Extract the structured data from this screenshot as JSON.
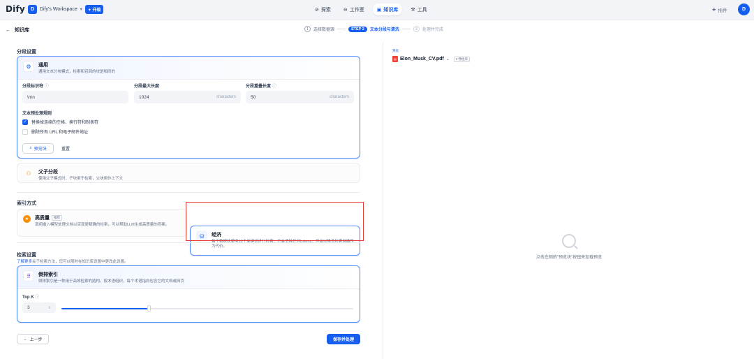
{
  "topbar": {
    "logo": "Dify",
    "workspace_initial": "D",
    "workspace_name": "Dify's Workspace",
    "upgrade_label": "升级",
    "nav": [
      {
        "label": "探索",
        "icon": "compass-icon"
      },
      {
        "label": "工作室",
        "icon": "robot-icon"
      },
      {
        "label": "知识库",
        "icon": "book-icon",
        "active": true
      },
      {
        "label": "工具",
        "icon": "tool-icon"
      }
    ],
    "plugins_label": "插件",
    "user_initial": "D"
  },
  "header": {
    "back_label": "知识库",
    "steps": {
      "step1_num": "1",
      "step1_label": "选择数据源",
      "step2_pill": "STEP 2",
      "step2_label": "文本分段与清洗",
      "step3_num": "3",
      "step3_label": "处理并完成"
    }
  },
  "segment": {
    "section_title": "分段设置",
    "general": {
      "title": "通用",
      "desc": "通用文本分块模式，检索和召回的块是相同的",
      "delimiter_label": "分段标识符",
      "delimiter_value": "\\n\\n",
      "maxlen_label": "分段最大长度",
      "maxlen_value": "1024",
      "maxlen_unit": "characters",
      "overlap_label": "分段重叠长度",
      "overlap_value": "50",
      "overlap_unit": "characters",
      "preprocess_title": "文本预处理规则",
      "rule1": "替换掉连续的空格、换行符和制表符",
      "rule1_checked": true,
      "rule2": "删除所有 URL 和电子邮件地址",
      "rule2_checked": false,
      "preview_btn": "预览块",
      "reset_btn": "重置"
    },
    "parent_child": {
      "title": "父子分段",
      "desc": "使用父子模式时，子块用于检索，父块用作上下文"
    }
  },
  "index": {
    "section_title": "索引方式",
    "high_quality": {
      "title": "高质量",
      "tag": "推荐",
      "desc": "调用嵌入模型处理文档以实现更精确的检索，可以帮助LLM生成高质量的答案。"
    },
    "economy": {
      "title": "经济",
      "desc": "每个数据块使用10个关键词进行检索，不会消耗任何tokens，但会以降低检索准确性为代价。"
    }
  },
  "retrieval": {
    "section_title": "检索设置",
    "learn_more": "了解更多",
    "subtitle": "关于检索方法，您可以随时在知识库设置中更改此设置。",
    "inverted": {
      "title": "倒排索引",
      "desc": "倒排索引是一种用于高效检索的结构。按术语组织，每个术语指向包含它的文档或网页"
    },
    "topk_label": "Top K",
    "topk_value": "3",
    "topk_slider_fraction": 0.3
  },
  "footer": {
    "prev_btn": "上一步",
    "save_btn": "保存并处理"
  },
  "preview": {
    "label": "预览",
    "file_name": "Elon_Musk_CV.pdf",
    "chunk_badge": "0 预估块",
    "empty_text": "点击左侧的\"预览块\"按钮来加载预览"
  },
  "colors": {
    "primary": "#155eef",
    "highlight_box": "#e53935"
  }
}
